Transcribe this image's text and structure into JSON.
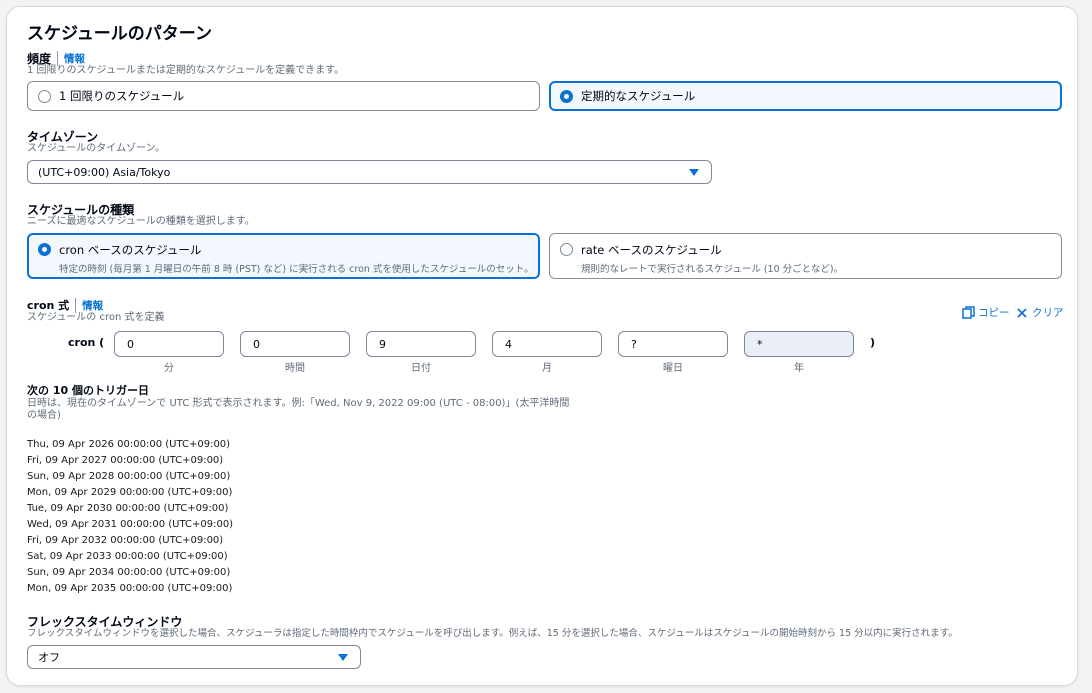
{
  "title": "スケジュールのパターン",
  "frequency": {
    "label": "頻度",
    "info": "情報",
    "description": "1 回限りのスケジュールまたは定期的なスケジュールを定義できます。",
    "options": [
      {
        "label": "1 回限りのスケジュール",
        "selected": false
      },
      {
        "label": "定期的なスケジュール",
        "selected": true
      }
    ]
  },
  "timezone": {
    "label": "タイムゾーン",
    "description": "スケジュールのタイムゾーン。",
    "value": "(UTC+09:00) Asia/Tokyo"
  },
  "schedule_type": {
    "label": "スケジュールの種類",
    "description": "ニーズに最適なスケジュールの種類を選択します。",
    "options": [
      {
        "label": "cron ベースのスケジュール",
        "sub": "特定の時刻 (毎月第 1 月曜日の午前 8 時 (PST) など) に実行される cron 式を使用したスケジュールのセット。",
        "selected": true
      },
      {
        "label": "rate ベースのスケジュール",
        "sub": "規則的なレートで実行されるスケジュール (10 分ごとなど)。",
        "selected": false
      }
    ]
  },
  "cron": {
    "label": "cron 式",
    "info": "情報",
    "description": "スケジュールの cron 式を定義",
    "copy_label": "コピー",
    "clear_label": "クリア",
    "open": "cron (",
    "close": ")",
    "fields": [
      {
        "value": "0",
        "caption": "分"
      },
      {
        "value": "0",
        "caption": "時間"
      },
      {
        "value": "9",
        "caption": "日付"
      },
      {
        "value": "4",
        "caption": "月"
      },
      {
        "value": "?",
        "caption": "曜日"
      },
      {
        "value": "*",
        "caption": "年"
      }
    ]
  },
  "triggers": {
    "label": "次の 10 個のトリガー日",
    "description_line1": "日時は、現在のタイムゾーンで UTC 形式で表示されます。例:「Wed, Nov 9, 2022 09:00 (UTC - 08:00)」(太平洋時間",
    "description_line2": "の場合)",
    "dates": [
      "Thu, 09 Apr 2026 00:00:00 (UTC+09:00)",
      "Fri, 09 Apr 2027 00:00:00 (UTC+09:00)",
      "Sun, 09 Apr 2028 00:00:00 (UTC+09:00)",
      "Mon, 09 Apr 2029 00:00:00 (UTC+09:00)",
      "Tue, 09 Apr 2030 00:00:00 (UTC+09:00)",
      "Wed, 09 Apr 2031 00:00:00 (UTC+09:00)",
      "Fri, 09 Apr 2032 00:00:00 (UTC+09:00)",
      "Sat, 09 Apr 2033 00:00:00 (UTC+09:00)",
      "Sun, 09 Apr 2034 00:00:00 (UTC+09:00)",
      "Mon, 09 Apr 2035 00:00:00 (UTC+09:00)"
    ]
  },
  "flex": {
    "label": "フレックスタイムウィンドウ",
    "description": "フレックスタイムウィンドウを選択した場合、スケジューラは指定した時間枠内でスケジュールを呼び出します。例えば、15 分を選択した場合、スケジュールはスケジュールの開始時刻から 15 分以内に実行されます。",
    "value": "オフ"
  },
  "icons": {
    "copy": "copy-icon",
    "clear": "close-icon",
    "caret": "caret-down-icon"
  },
  "colors": {
    "accent": "#0972d3",
    "selected_bg": "#f2f8fd"
  }
}
